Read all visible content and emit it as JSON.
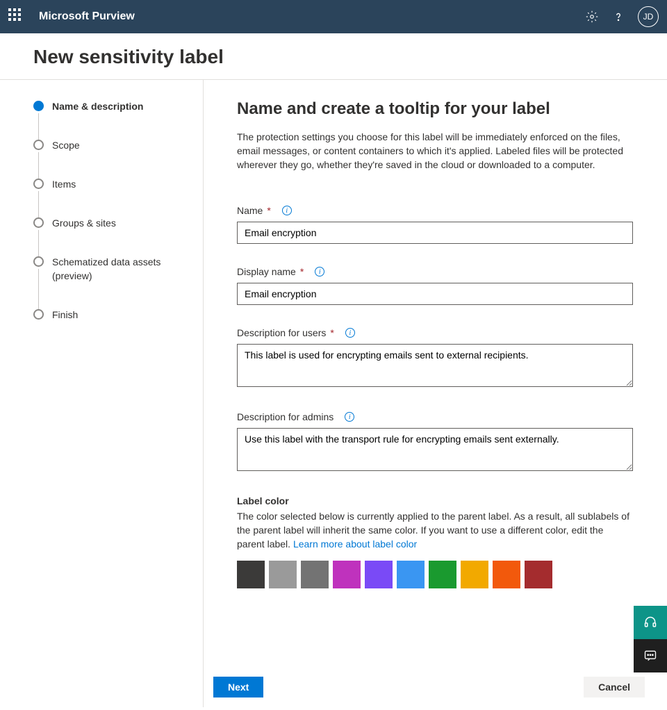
{
  "app_title": "Microsoft Purview",
  "user_initials": "JD",
  "page_title": "New sensitivity label",
  "steps": [
    {
      "label": "Name & description",
      "active": true
    },
    {
      "label": "Scope",
      "active": false
    },
    {
      "label": "Items",
      "active": false
    },
    {
      "label": "Groups & sites",
      "active": false
    },
    {
      "label": "Schematized data assets (preview)",
      "active": false
    },
    {
      "label": "Finish",
      "active": false
    }
  ],
  "content": {
    "heading": "Name and create a tooltip for your label",
    "intro": "The protection settings you choose for this label will be immediately enforced on the files, email messages, or content containers to which it's applied. Labeled files will be protected wherever they go, whether they're saved in the cloud or downloaded to a computer.",
    "fields": {
      "name": {
        "label": "Name",
        "value": "Email encryption",
        "required": true,
        "info": true
      },
      "display_name": {
        "label": "Display name",
        "value": "Email encryption",
        "required": true,
        "info": true
      },
      "desc_users": {
        "label": "Description for users",
        "value": "This label is used for encrypting emails sent to external recipients.",
        "required": true,
        "info": true
      },
      "desc_admins": {
        "label": "Description for admins",
        "value": "Use this label with the transport rule for encrypting emails sent externally.",
        "required": false,
        "info": true
      }
    },
    "label_color": {
      "title": "Label color",
      "text": "The color selected below is currently applied to the parent label. As a result, all sublabels of the parent label will inherit the same color. If you want to use a different color, edit the parent label. ",
      "link": "Learn more about label color",
      "colors": [
        "#3b3a39",
        "#9a9a9a",
        "#737373",
        "#bf32bd",
        "#7a4af6",
        "#3a96f2",
        "#1a9a2f",
        "#f2a900",
        "#f2590c",
        "#a42c2e"
      ]
    }
  },
  "footer": {
    "next": "Next",
    "cancel": "Cancel"
  }
}
